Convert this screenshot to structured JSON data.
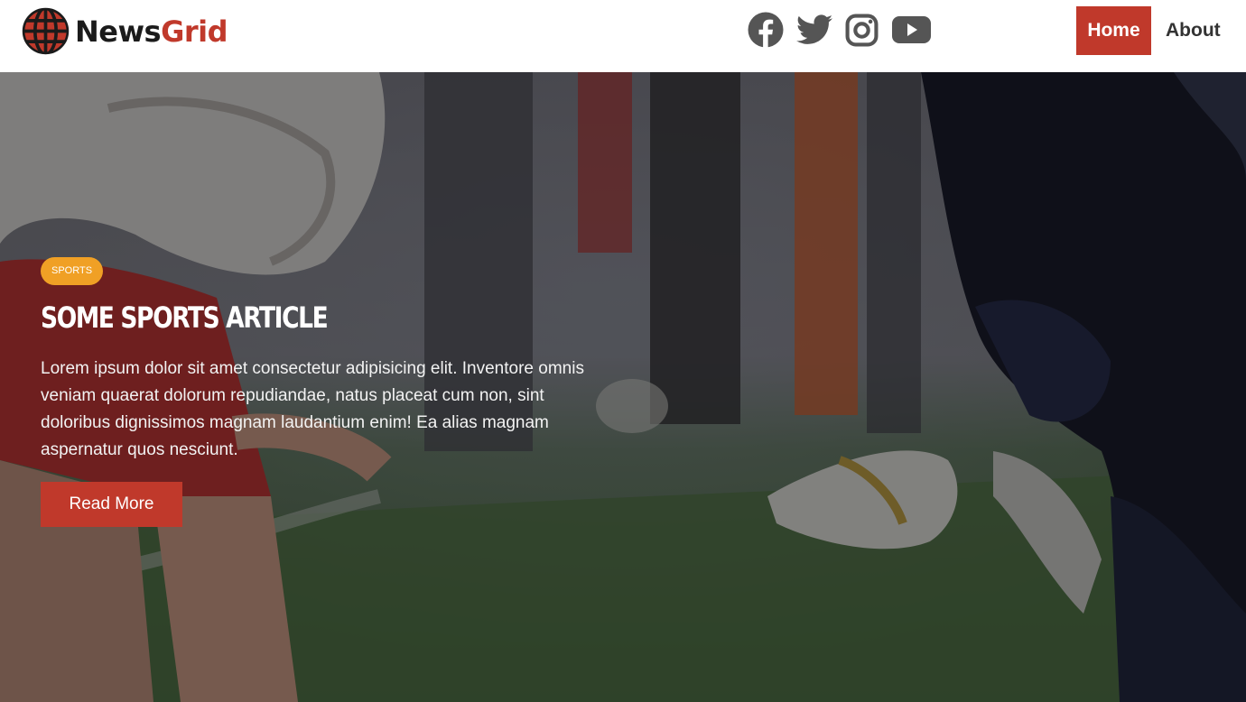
{
  "header": {
    "logo": {
      "part1": "News",
      "part2": "Grid",
      "icon": "globe-icon"
    },
    "social": [
      {
        "name": "facebook",
        "icon": "facebook-icon"
      },
      {
        "name": "twitter",
        "icon": "twitter-icon"
      },
      {
        "name": "instagram",
        "icon": "instagram-icon"
      },
      {
        "name": "youtube",
        "icon": "youtube-icon"
      }
    ],
    "nav": [
      {
        "label": "Home",
        "active": true
      },
      {
        "label": "About",
        "active": false
      }
    ]
  },
  "hero": {
    "background": "american-football-line-of-scrimmage-photo",
    "category": "SPORTS",
    "title": "SOME SPORTS ARTICLE",
    "body": "Lorem ipsum dolor sit amet consectetur adipisicing elit. Inventore omnis veniam quaerat dolorum repudiandae, natus placeat cum non, sint doloribus dignissimos magnam laudantium enim! Ea alias magnam aspernatur quos nesciunt.",
    "cta": "Read More"
  },
  "colors": {
    "brand_red": "#c0392b",
    "badge_orange": "#f0a025",
    "icon_gray": "#555555",
    "logo_dark": "#1b1b1b"
  }
}
